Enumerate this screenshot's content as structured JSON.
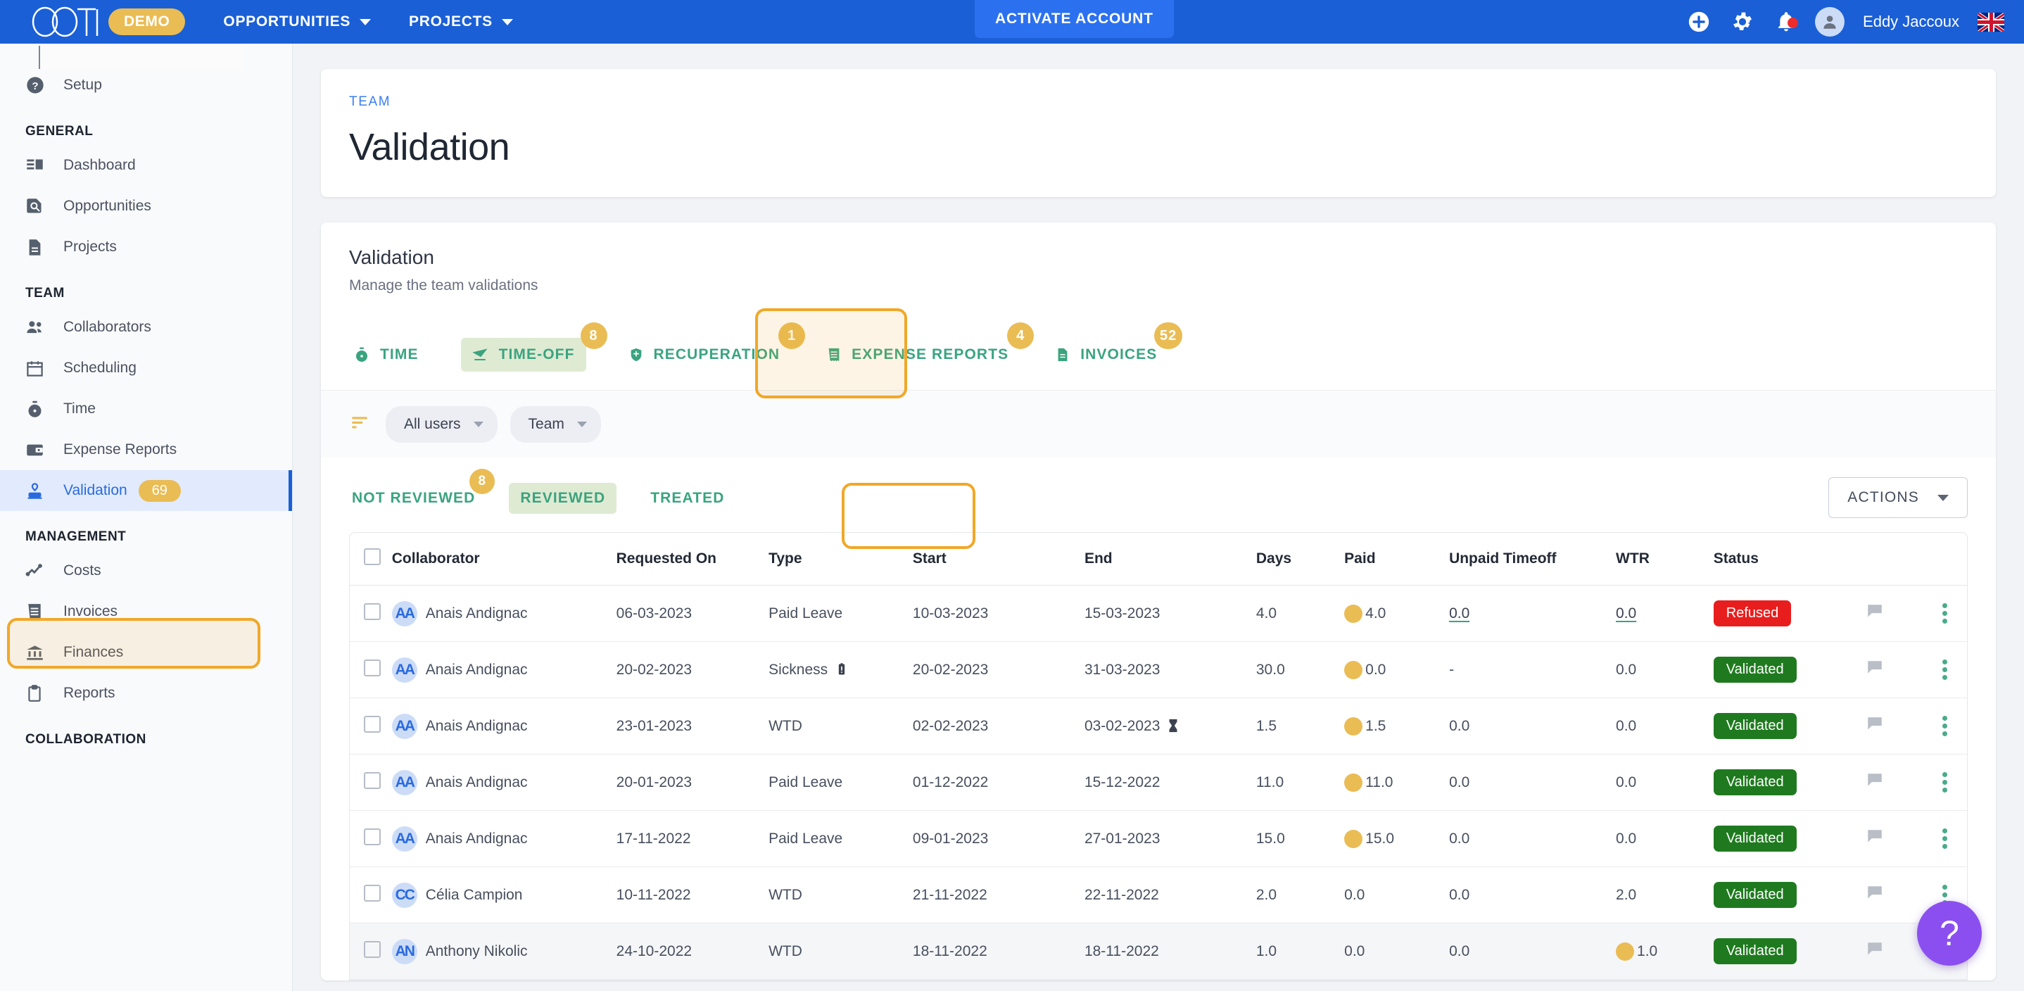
{
  "topbar": {
    "logo": "OOTI",
    "demo_label": "DEMO",
    "nav": [
      {
        "label": "OPPORTUNITIES",
        "caret": true
      },
      {
        "label": "PROJECTS",
        "caret": true
      }
    ],
    "activate_label": "ACTIVATE ACCOUNT",
    "user_name": "Eddy Jaccoux",
    "icons": [
      "add-icon",
      "gear-icon",
      "bell-icon",
      "avatar-icon",
      "flag-uk-icon"
    ],
    "brand_color": "#1a5fd6",
    "accent_color": "#eabc54"
  },
  "sidebar": {
    "setup": {
      "label": "Setup",
      "icon": "help-circle-icon"
    },
    "sections": [
      {
        "title": "GENERAL",
        "items": [
          {
            "label": "Dashboard",
            "icon": "dashboard-icon"
          },
          {
            "label": "Opportunities",
            "icon": "doc-search-icon"
          },
          {
            "label": "Projects",
            "icon": "document-icon"
          }
        ]
      },
      {
        "title": "TEAM",
        "items": [
          {
            "label": "Collaborators",
            "icon": "people-icon"
          },
          {
            "label": "Scheduling",
            "icon": "calendar-icon"
          },
          {
            "label": "Time",
            "icon": "stopwatch-icon"
          },
          {
            "label": "Expense Reports",
            "icon": "wallet-icon"
          },
          {
            "label": "Validation",
            "icon": "stamp-icon",
            "badge": "69",
            "active": true
          }
        ]
      },
      {
        "title": "MANAGEMENT",
        "items": [
          {
            "label": "Costs",
            "icon": "trend-line-icon"
          },
          {
            "label": "Invoices",
            "icon": "receipt-icon"
          },
          {
            "label": "Finances",
            "icon": "bank-icon"
          },
          {
            "label": "Reports",
            "icon": "clipboard-icon"
          }
        ]
      },
      {
        "title": "COLLABORATION",
        "items": []
      }
    ]
  },
  "page": {
    "breadcrumb": "TEAM",
    "title": "Validation"
  },
  "panel": {
    "title": "Validation",
    "subtitle": "Manage the team validations",
    "tabs": [
      {
        "label": "TIME",
        "icon": "stopwatch-icon",
        "badge": "",
        "selected": false
      },
      {
        "label": "TIME-OFF",
        "icon": "timeoff-icon",
        "badge": "8",
        "selected": true
      },
      {
        "label": "RECUPERATION",
        "icon": "shield-icon",
        "badge": "1",
        "selected": false
      },
      {
        "label": "EXPENSE REPORTS",
        "icon": "receipt-icon",
        "badge": "4",
        "selected": false
      },
      {
        "label": "INVOICES",
        "icon": "invoice-icon",
        "badge": "52",
        "selected": false
      }
    ],
    "filters": {
      "icon": "filter-icon",
      "chips": [
        {
          "label": "All users"
        },
        {
          "label": "Team"
        }
      ]
    },
    "subtabs": [
      {
        "label": "NOT REVIEWED",
        "badge": "8",
        "selected": false
      },
      {
        "label": "REVIEWED",
        "badge": "",
        "selected": true
      },
      {
        "label": "TREATED",
        "badge": "",
        "selected": false
      }
    ],
    "actions_label": "ACTIONS"
  },
  "table": {
    "columns": [
      "Collaborator",
      "Requested On",
      "Type",
      "Start",
      "End",
      "Days",
      "Paid",
      "Unpaid Timeoff",
      "WTR",
      "Status"
    ],
    "rows": [
      {
        "initials": "AA",
        "name": "Anais  Andignac",
        "requested_on": "06-03-2023",
        "type": "Paid Leave",
        "type_icon": "",
        "start": "10-03-2023",
        "end": "15-03-2023",
        "end_icon": "",
        "days": "4.0",
        "paid": "4.0",
        "paid_dot": true,
        "unpaid": "0.0",
        "unpaid_link": true,
        "wtr": "0.0",
        "wtr_link": true,
        "wtr_dot": false,
        "status": "Refused",
        "status_kind": "no",
        "shaded": false
      },
      {
        "initials": "AA",
        "name": "Anais  Andignac",
        "requested_on": "20-02-2023",
        "type": "Sickness",
        "type_icon": "attachment-icon",
        "start": "20-02-2023",
        "end": "31-03-2023",
        "end_icon": "",
        "days": "30.0",
        "paid": "0.0",
        "paid_dot": true,
        "unpaid": "-",
        "unpaid_link": false,
        "wtr": "0.0",
        "wtr_link": false,
        "wtr_dot": false,
        "status": "Validated",
        "status_kind": "ok",
        "shaded": false
      },
      {
        "initials": "AA",
        "name": "Anais  Andignac",
        "requested_on": "23-01-2023",
        "type": "WTD",
        "type_icon": "",
        "start": "02-02-2023",
        "end": "03-02-2023",
        "end_icon": "hourglass-icon",
        "days": "1.5",
        "paid": "1.5",
        "paid_dot": true,
        "unpaid": "0.0",
        "unpaid_link": false,
        "wtr": "0.0",
        "wtr_link": false,
        "wtr_dot": false,
        "status": "Validated",
        "status_kind": "ok",
        "shaded": false
      },
      {
        "initials": "AA",
        "name": "Anais  Andignac",
        "requested_on": "20-01-2023",
        "type": "Paid Leave",
        "type_icon": "",
        "start": "01-12-2022",
        "end": "15-12-2022",
        "end_icon": "",
        "days": "11.0",
        "paid": "11.0",
        "paid_dot": true,
        "unpaid": "0.0",
        "unpaid_link": false,
        "wtr": "0.0",
        "wtr_link": false,
        "wtr_dot": false,
        "status": "Validated",
        "status_kind": "ok",
        "shaded": false
      },
      {
        "initials": "AA",
        "name": "Anais  Andignac",
        "requested_on": "17-11-2022",
        "type": "Paid Leave",
        "type_icon": "",
        "start": "09-01-2023",
        "end": "27-01-2023",
        "end_icon": "",
        "days": "15.0",
        "paid": "15.0",
        "paid_dot": true,
        "unpaid": "0.0",
        "unpaid_link": false,
        "wtr": "0.0",
        "wtr_link": false,
        "wtr_dot": false,
        "status": "Validated",
        "status_kind": "ok",
        "shaded": false
      },
      {
        "initials": "CC",
        "name": "Célia  Campion",
        "requested_on": "10-11-2022",
        "type": "WTD",
        "type_icon": "",
        "start": "21-11-2022",
        "end": "22-11-2022",
        "end_icon": "",
        "days": "2.0",
        "paid": "0.0",
        "paid_dot": false,
        "unpaid": "0.0",
        "unpaid_link": false,
        "wtr": "2.0",
        "wtr_link": false,
        "wtr_dot": false,
        "status": "Validated",
        "status_kind": "ok",
        "shaded": false
      },
      {
        "initials": "AN",
        "name": "Anthony  Nikolic",
        "requested_on": "24-10-2022",
        "type": "WTD",
        "type_icon": "",
        "start": "18-11-2022",
        "end": "18-11-2022",
        "end_icon": "",
        "days": "1.0",
        "paid": "0.0",
        "paid_dot": false,
        "unpaid": "0.0",
        "unpaid_link": false,
        "wtr": "1.0",
        "wtr_link": false,
        "wtr_dot": true,
        "status": "Validated",
        "status_kind": "ok",
        "shaded": true
      }
    ]
  },
  "help_fab": {
    "icon": "question-icon",
    "label": "?"
  }
}
